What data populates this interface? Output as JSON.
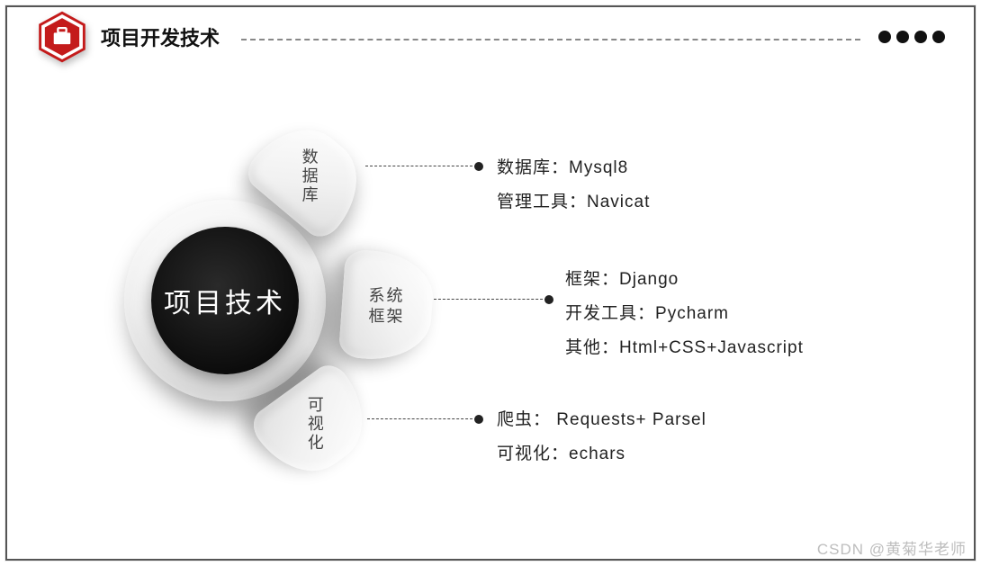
{
  "header": {
    "title": "项目开发技术",
    "icon": "briefcase-icon"
  },
  "center": {
    "label": "项目技术"
  },
  "petals": {
    "top": {
      "label": "数据库"
    },
    "right": {
      "label_line1": "系统",
      "label_line2": "框架"
    },
    "bottom": {
      "label": "可视化"
    }
  },
  "details": {
    "database": [
      {
        "label": "数据库：",
        "value": "Mysql8"
      },
      {
        "label": "管理工具：",
        "value": "Navicat"
      }
    ],
    "framework": [
      {
        "label": "框架：",
        "value": "Django"
      },
      {
        "label": "开发工具：",
        "value": "Pycharm"
      },
      {
        "label": "其他：",
        "value": "Html+CSS+Javascript"
      }
    ],
    "visual": [
      {
        "label": "爬虫：",
        "value": " Requests+ Parsel"
      },
      {
        "label": "可视化：",
        "value": "echars"
      }
    ]
  },
  "watermark": "CSDN @黄菊华老师"
}
